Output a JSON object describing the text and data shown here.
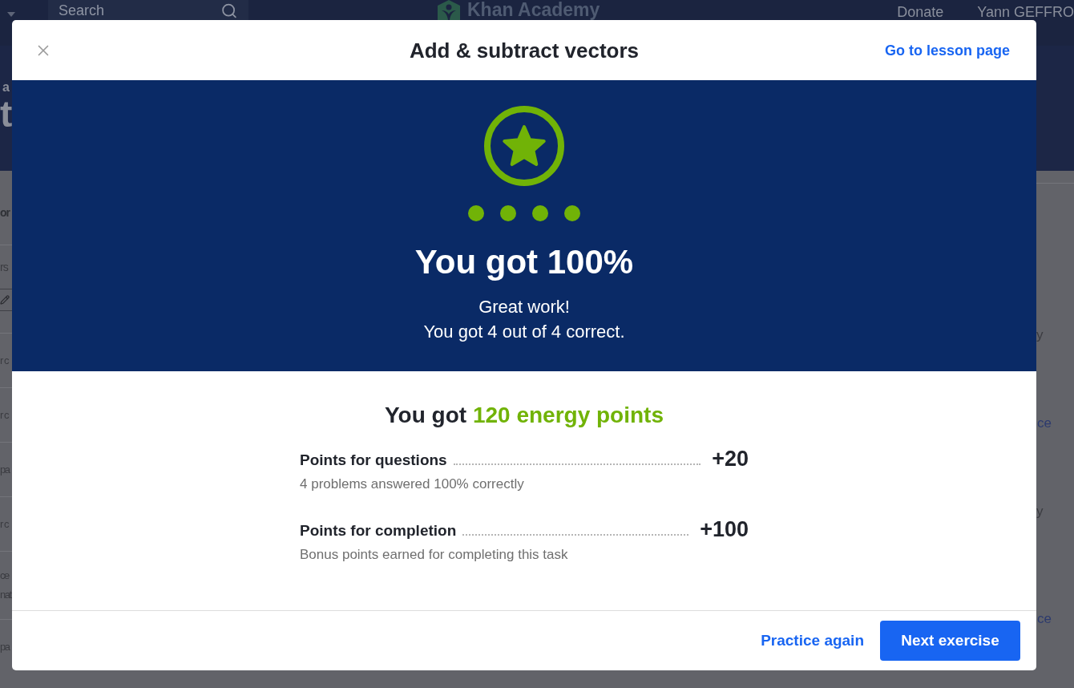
{
  "background_page": {
    "top_bar": {
      "search": {
        "placeholder": "Search"
      },
      "logo_text": "Khan Academy",
      "links": [
        "Donate",
        "Yann GEFFRO"
      ]
    },
    "header_fragments": [
      "a",
      "t"
    ],
    "left_column": [
      {
        "kind": "title",
        "lines": [
          "or"
        ]
      },
      {
        "kind": "label",
        "lines": [
          "rs"
        ]
      },
      {
        "kind": "edit_box"
      },
      {
        "kind": "text",
        "lines": [
          "r c"
        ]
      },
      {
        "kind": "text",
        "lines": [
          "r c"
        ]
      },
      {
        "kind": "text",
        "lines": [
          "pa"
        ]
      },
      {
        "kind": "text",
        "lines": [
          "r c"
        ]
      },
      {
        "kind": "text",
        "lines": [
          "ce",
          "nat"
        ]
      },
      {
        "kind": "text",
        "lines": [
          "pa"
        ]
      }
    ],
    "right_column": [
      {
        "kind": "text",
        "text": "y"
      },
      {
        "kind": "link",
        "text": "ce"
      },
      {
        "kind": "text",
        "text": "y"
      },
      {
        "kind": "link",
        "text": "ce"
      }
    ]
  },
  "dialog": {
    "title": "Add & subtract vectors",
    "header_link": "Go to lesson page",
    "result": {
      "problems": [
        {
          "correct": true
        },
        {
          "correct": true
        },
        {
          "correct": true
        },
        {
          "correct": true
        }
      ],
      "score": "You got 100%",
      "message_lines": [
        "Great work!",
        "You got 4 out of 4 correct."
      ]
    },
    "points": {
      "heading": "You got",
      "total": "120 energy points",
      "items": [
        {
          "label": "Points for questions",
          "value": "+20",
          "detail": "4 problems answered 100% correctly"
        },
        {
          "label": "Points for completion",
          "value": "+100",
          "detail": "Bonus points earned for completing this task"
        }
      ]
    },
    "footer": {
      "secondary_button": "Practice again",
      "primary_button": "Next exercise"
    }
  }
}
